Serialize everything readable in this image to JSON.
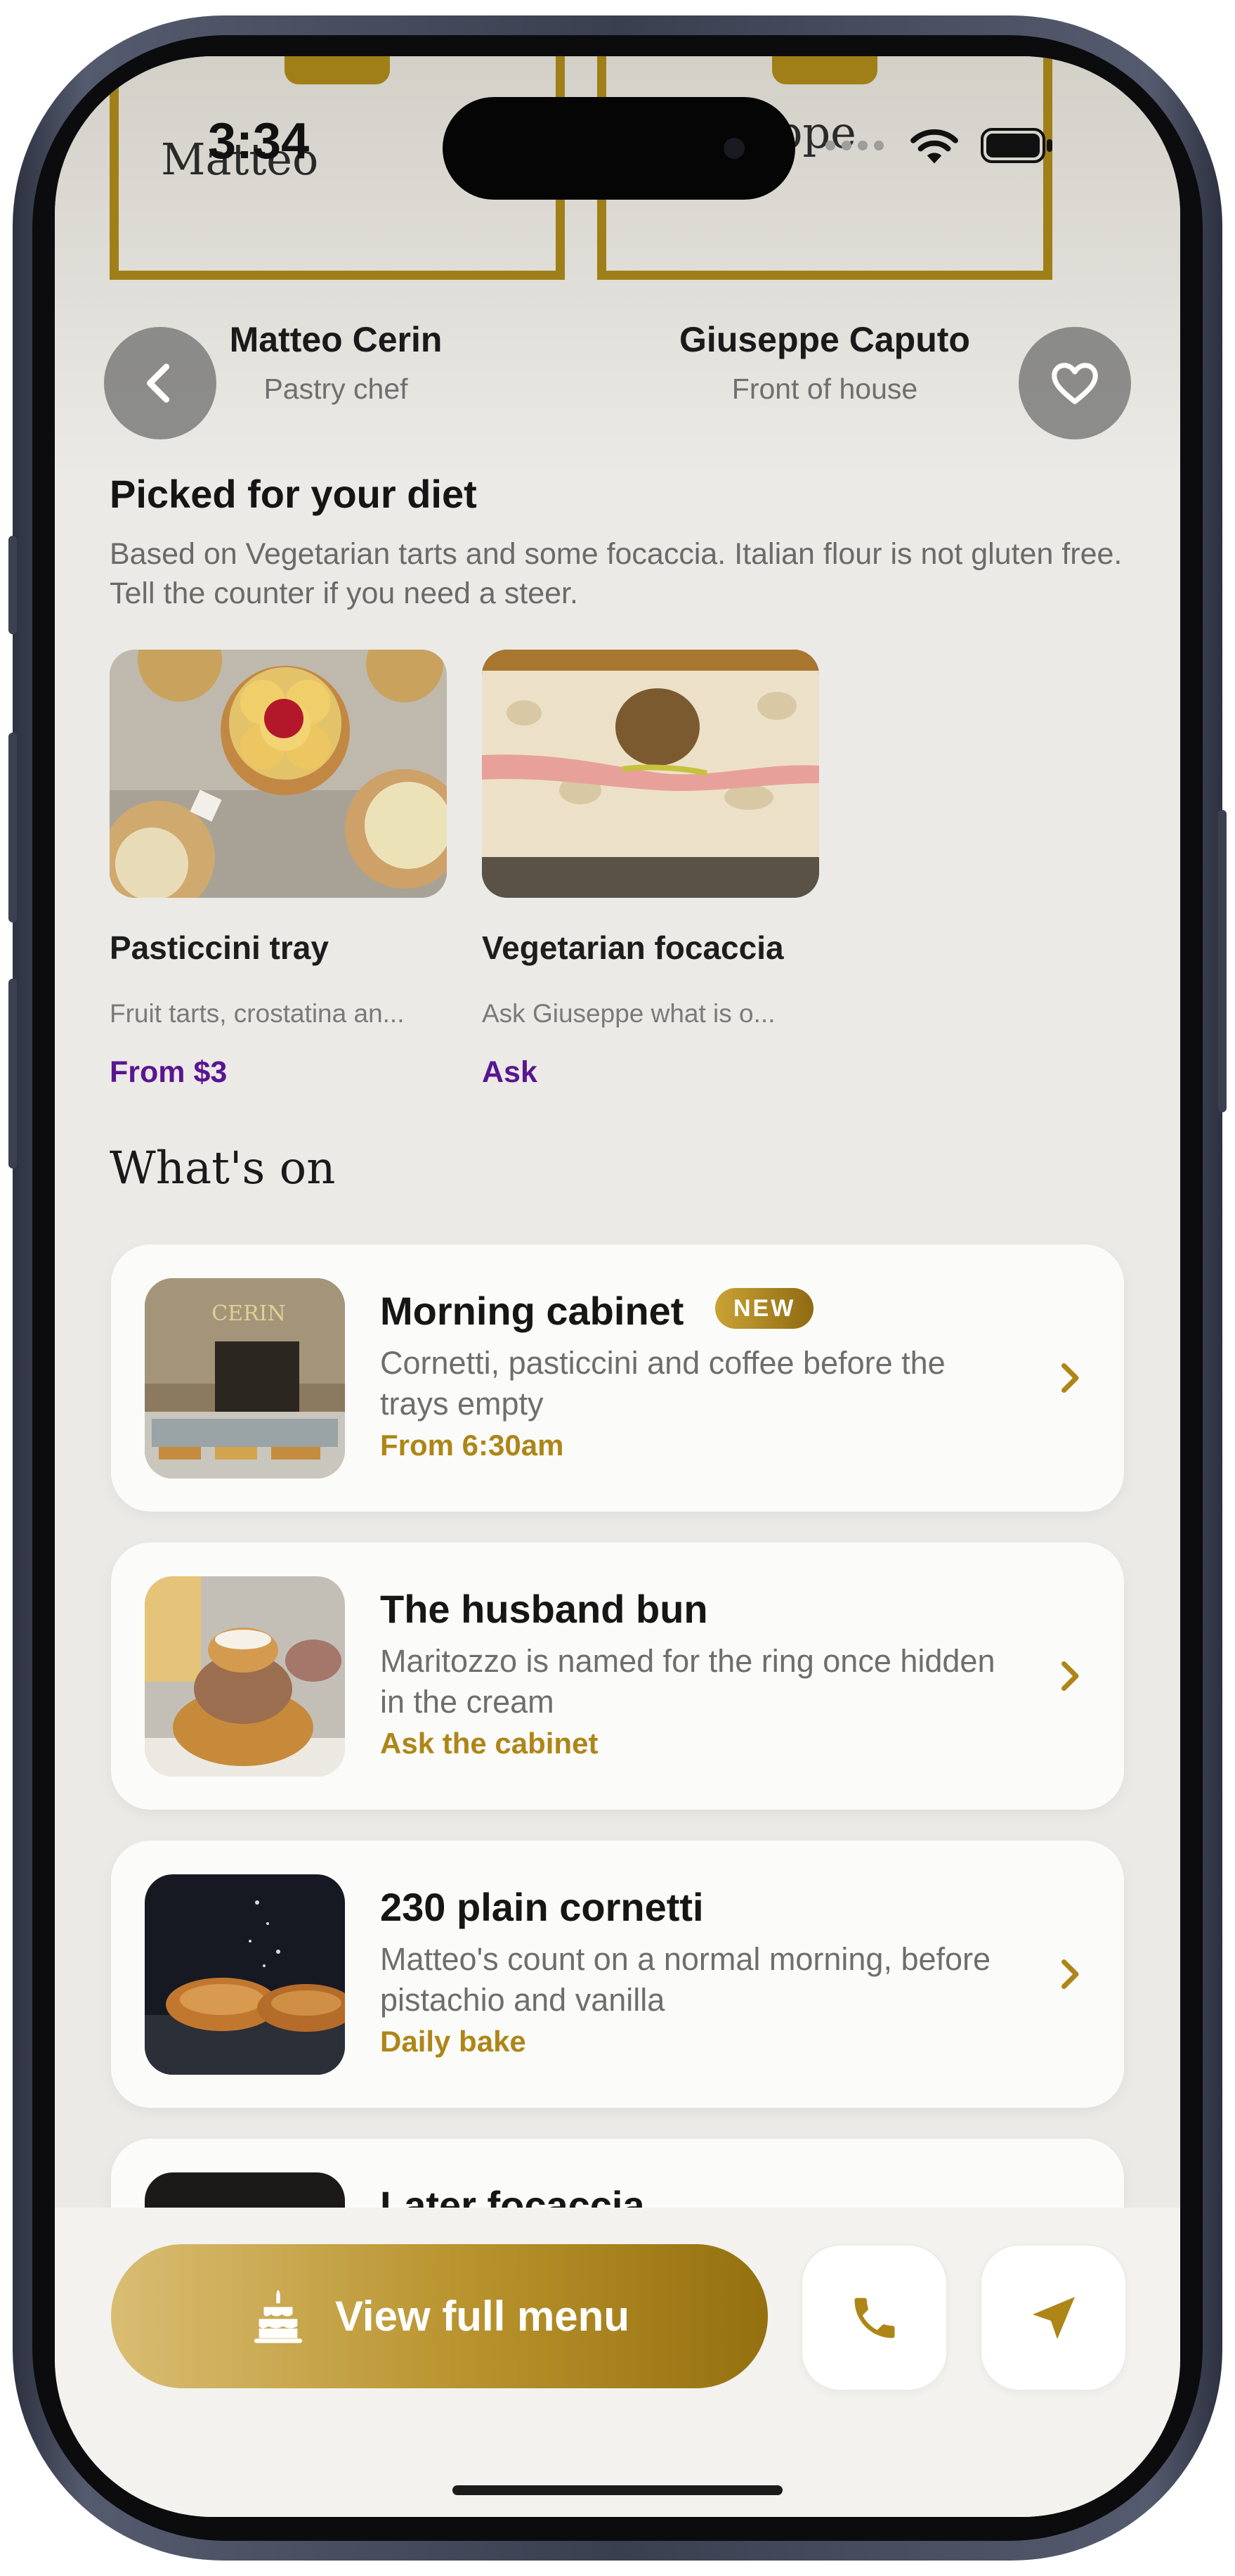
{
  "status_bar": {
    "time": "3:34"
  },
  "hero": {
    "frame_left_text": "Matteo",
    "frame_right_text": "Giuseppe",
    "people": [
      {
        "name": "Matteo Cerin",
        "role": "Pastry chef"
      },
      {
        "name": "Giuseppe Caputo",
        "role": "Front of house"
      }
    ],
    "back_icon": "chevron-left-icon",
    "favorite_icon": "heart-icon"
  },
  "diet": {
    "title": "Picked for your diet",
    "description": "Based on Vegetarian tarts and some focaccia. Italian flour is not gluten free. Tell the counter if you need a steer.",
    "cards": [
      {
        "title": "Pasticcini tray",
        "subtitle": "Fruit tarts, crostatina an...",
        "price": "From $3"
      },
      {
        "title": "Vegetarian focaccia",
        "subtitle": "Ask Giuseppe what is o...",
        "price": "Ask"
      }
    ]
  },
  "whats_on": {
    "title": "What's on",
    "items": [
      {
        "title": "Morning cabinet",
        "badge": "NEW",
        "description": "Cornetti, pasticcini and coffee before the trays empty",
        "meta": "From 6:30am",
        "sign": "CERIN"
      },
      {
        "title": "The husband bun",
        "description": "Maritozzo is named for the ring once hidden in the cream",
        "meta": "Ask the cabinet"
      },
      {
        "title": "230 plain cornetti",
        "description": "Matteo's count on a normal morning, before pistachio and vanilla",
        "meta": "Daily bake"
      },
      {
        "title": "Later focaccia"
      }
    ]
  },
  "bottom_bar": {
    "menu_label": "View full menu",
    "menu_icon": "cake-icon",
    "call_icon": "phone-icon",
    "directions_icon": "navigation-arrow-icon"
  },
  "colors": {
    "accent_gold": "#ae8618",
    "price_purple": "#5a1590",
    "background": "#ebeae6"
  }
}
